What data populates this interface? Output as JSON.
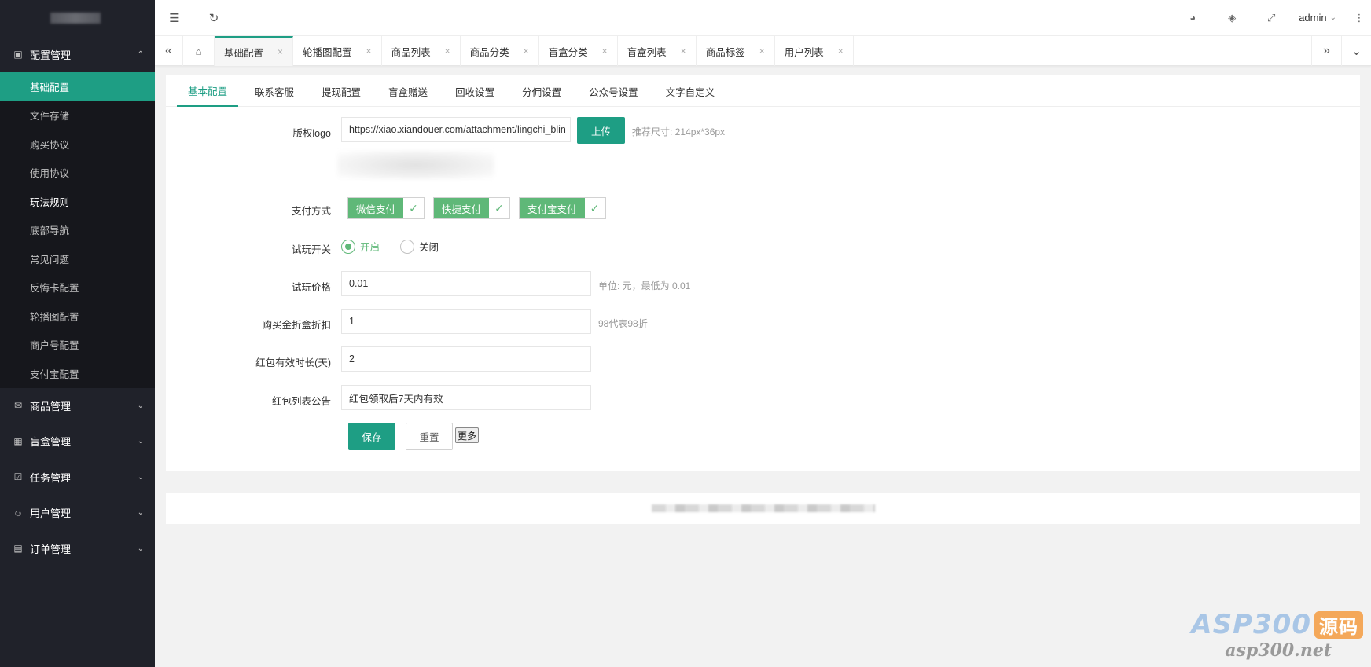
{
  "sidebar": {
    "groups": [
      {
        "label": "配置管理",
        "icon": "settings-icon",
        "expanded": true,
        "items": [
          {
            "label": "基础配置"
          },
          {
            "label": "文件存储"
          },
          {
            "label": "购买协议"
          },
          {
            "label": "使用协议"
          },
          {
            "label": "玩法规则"
          },
          {
            "label": "底部导航"
          },
          {
            "label": "常见问题"
          },
          {
            "label": "反悔卡配置"
          },
          {
            "label": "轮播图配置"
          },
          {
            "label": "商户号配置"
          },
          {
            "label": "支付宝配置"
          }
        ]
      },
      {
        "label": "商品管理",
        "icon": "goods-icon"
      },
      {
        "label": "盲盒管理",
        "icon": "gift-icon"
      },
      {
        "label": "任务管理",
        "icon": "task-icon"
      },
      {
        "label": "用户管理",
        "icon": "user-icon"
      },
      {
        "label": "订单管理",
        "icon": "order-icon"
      }
    ]
  },
  "topbar": {
    "user": "admin"
  },
  "tabs": [
    {
      "label": "基础配置",
      "active": true
    },
    {
      "label": "轮播图配置"
    },
    {
      "label": "商品列表"
    },
    {
      "label": "商品分类"
    },
    {
      "label": "盲盒分类"
    },
    {
      "label": "盲盒列表"
    },
    {
      "label": "商品标签"
    },
    {
      "label": "用户列表"
    }
  ],
  "subtabs": [
    "基本配置",
    "联系客服",
    "提现配置",
    "盲盒赠送",
    "回收设置",
    "分佣设置",
    "公众号设置",
    "文字自定义"
  ],
  "form": {
    "logo": {
      "label": "版权logo",
      "value": "https://xiao.xiandouer.com/attachment/lingchi_blin",
      "upload": "上传",
      "hint": "推荐尺寸: 214px*36px"
    },
    "payment": {
      "label": "支付方式",
      "options": [
        "微信支付",
        "快捷支付",
        "支付宝支付"
      ]
    },
    "trial_switch": {
      "label": "试玩开关",
      "on": "开启",
      "off": "关闭"
    },
    "trial_price": {
      "label": "试玩价格",
      "value": "0.01",
      "hint": "单位: 元，最低为 0.01"
    },
    "discount": {
      "label": "购买金折盒折扣",
      "value": "1",
      "hint": "98代表98折"
    },
    "redpack_days": {
      "label": "红包有效时长(天)",
      "value": "2"
    },
    "redpack_notice": {
      "label": "红包列表公告",
      "value": "红包领取后7天内有效"
    },
    "buttons": {
      "save": "保存",
      "reset": "重置",
      "more": "更多"
    }
  },
  "watermark": {
    "brand": "ASP300",
    "badge": "源码",
    "url": "asp300.net"
  },
  "colors": {
    "accent": "#1e9e84",
    "sidebar_bg": "#20222a",
    "checkbox_green": "#5fb878"
  }
}
